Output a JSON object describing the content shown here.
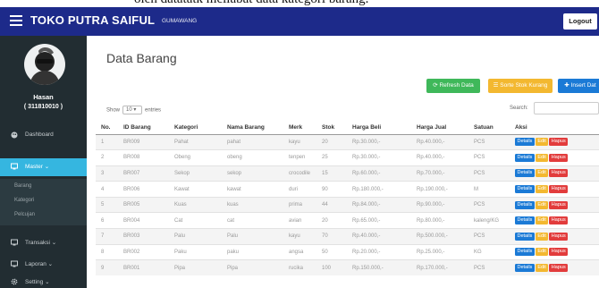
{
  "caption": "oleh datatatk meliabat data kategori barang.",
  "header": {
    "brand": "TOKO PUTRA SAIFUL",
    "subtitle": "GUMAWANG",
    "logout": "Logout"
  },
  "user": {
    "name": "Hasan",
    "id": "( 311810010 )"
  },
  "sidebar": {
    "dashboard": "Dashboard",
    "master": "Master",
    "sub_items": [
      "Barang",
      "Kategori",
      "Pelcujan"
    ],
    "transaksi": "Transaksi",
    "laporan": "Laporan",
    "setting": "Setting"
  },
  "main": {
    "title": "Data Barang",
    "buttons": {
      "refresh": "Refresh Data",
      "sort": "Sorte Stok Kurang",
      "insert": "Insert Dat"
    },
    "show_prefix": "Show",
    "show_value": "10",
    "show_suffix": "entries",
    "search_label": "Search:"
  },
  "table": {
    "headers": [
      "No.",
      "ID Barang",
      "Kategori",
      "Nama Barang",
      "Merk",
      "Stok",
      "Harga Beli",
      "Harga Jual",
      "Satuan",
      "Aksi"
    ],
    "actions": {
      "details": "Details",
      "edit": "Edit",
      "hapus": "Hapus"
    },
    "rows": [
      [
        "1",
        "BR009",
        "Pahat",
        "pahat",
        "kayu",
        "20",
        "Rp.30.000,-",
        "Rp.40.000,-",
        "PCS"
      ],
      [
        "2",
        "BR008",
        "Obeng",
        "obeng",
        "tenpen",
        "25",
        "Rp.30.000,-",
        "Rp.40.000,-",
        "PCS"
      ],
      [
        "3",
        "BR007",
        "Sekop",
        "sekop",
        "crocodile",
        "15",
        "Rp.60.000,-",
        "Rp.70.000,-",
        "PCS"
      ],
      [
        "4",
        "BR006",
        "Kawat",
        "kawat",
        "duri",
        "90",
        "Rp.180.000,-",
        "Rp.190.000,-",
        "M"
      ],
      [
        "5",
        "BR005",
        "Kuas",
        "kuas",
        "prima",
        "44",
        "Rp.84.000,-",
        "Rp.90.000,-",
        "PCS"
      ],
      [
        "6",
        "BR004",
        "Cat",
        "cat",
        "avian",
        "20",
        "Rp.65.000,-",
        "Rp.80.000,-",
        "kaleng/KG"
      ],
      [
        "7",
        "BR003",
        "Palu",
        "Palu",
        "kayu",
        "70",
        "Rp.40.000,-",
        "Rp.500.000,-",
        "PCS"
      ],
      [
        "8",
        "BR002",
        "Paku",
        "paku",
        "angsa",
        "50",
        "Rp.20.000,-",
        "Rp.25.000,-",
        "KG"
      ],
      [
        "9",
        "BR001",
        "Pipa",
        "Pipa",
        "rucika",
        "100",
        "Rp.150.000,-",
        "Rp.170.000,-",
        "PCS"
      ]
    ]
  },
  "colors": {
    "topbar": "#1d2a8a",
    "sidebar": "#222d32",
    "active": "#35b6e0",
    "refresh": "#3fb85a",
    "sort": "#f3b830",
    "insert": "#1b7ad6",
    "hapus": "#e23c3c"
  }
}
